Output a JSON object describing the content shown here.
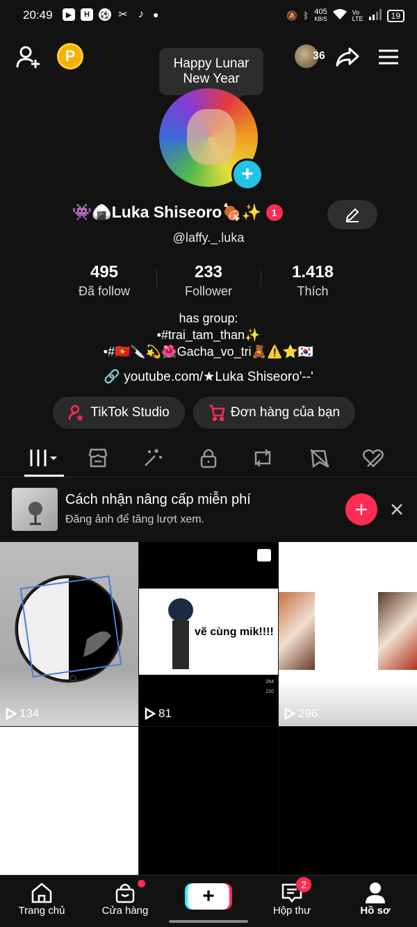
{
  "status_bar": {
    "time": "20:49",
    "network_speed": "405",
    "network_unit": "KB/S",
    "lte": "Vo LTE",
    "battery": "19"
  },
  "header": {
    "coin_label": "P",
    "friends_count": "36",
    "tooltip": "Happy Lunar New Year"
  },
  "profile": {
    "display_name": "👾🍙Luka Shiseoro🍖✨",
    "notification_count": "1",
    "handle": "@laffy._.luka",
    "stats": [
      {
        "value": "495",
        "label": "Đã follow"
      },
      {
        "value": "233",
        "label": "Follower"
      },
      {
        "value": "1.418",
        "label": "Thích"
      }
    ],
    "bio_lines": [
      "has group:",
      "•#trai_tam_than✨",
      "•#🇻🇳🔪💫🌺Gacha_vo_tri🧸⚠️⭐🇰🇷"
    ],
    "link": "youtube.com/★Luka Shiseoro'--'"
  },
  "actions": {
    "studio": "TikTok Studio",
    "orders": "Đơn hàng của bạn"
  },
  "upgrade_banner": {
    "title": "Cách nhận nâng cấp miễn phí",
    "subtitle": "Đăng ảnh để tăng lượt xem."
  },
  "videos": [
    {
      "views": "134"
    },
    {
      "views": "81",
      "overlay_text": "vẽ cùng mik!!!!"
    },
    {
      "views": "296"
    }
  ],
  "side_counts": [
    "264",
    "210"
  ],
  "bottom_nav": {
    "home": "Trang chủ",
    "shop": "Cửa hàng",
    "inbox": "Hộp thư",
    "inbox_badge": "2",
    "profile": "Hồ sơ"
  }
}
